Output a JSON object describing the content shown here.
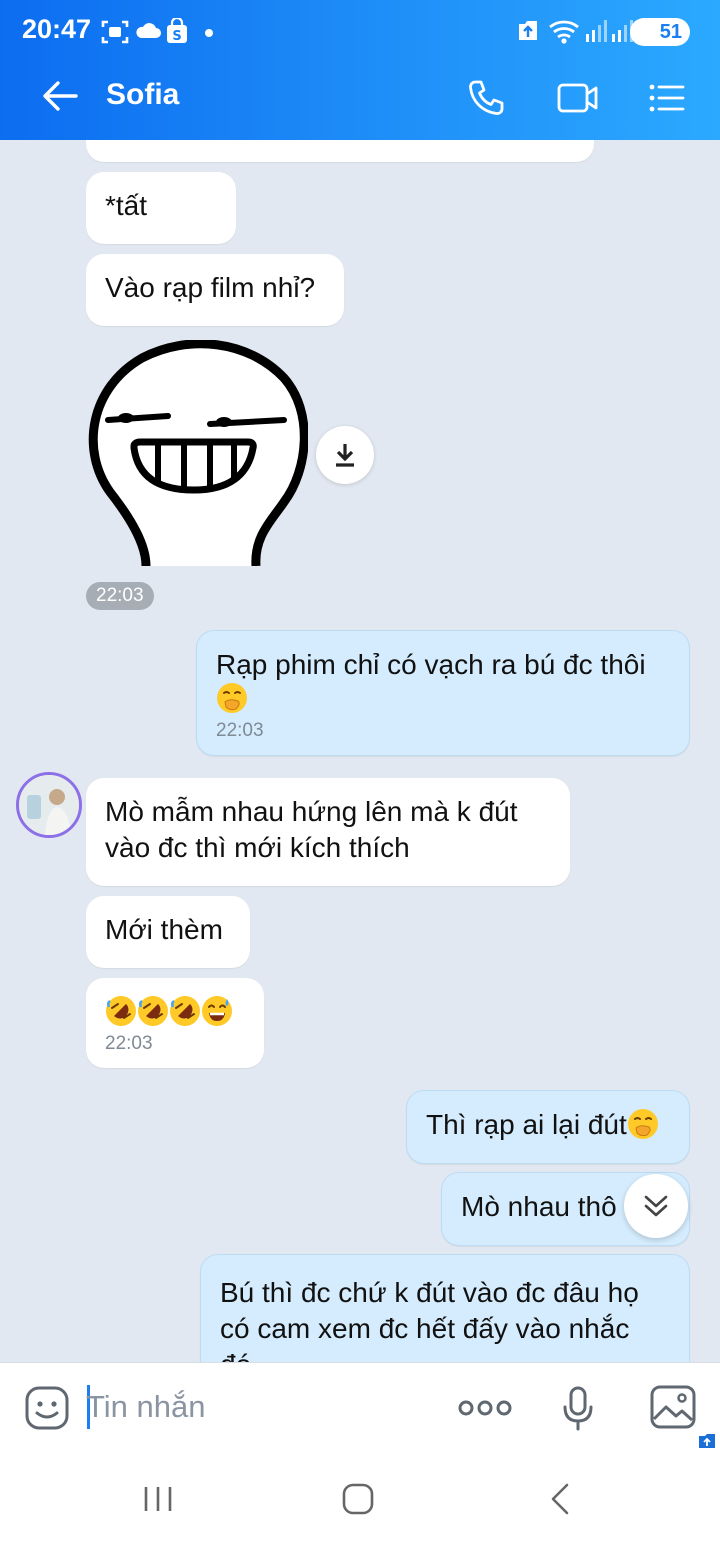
{
  "status_bar": {
    "time": "20:47",
    "battery": "51"
  },
  "header": {
    "contact_name": "Sofia"
  },
  "messages": {
    "m0": "*tất",
    "m1": "Vào rạp film nhỉ?",
    "sticker_time": "22:03",
    "m2_text": "Rạp phim chỉ có vạch ra bú đc thôi",
    "m2_time": "22:03",
    "m3_line1": "Mò mẫm nhau hứng lên mà k đút",
    "m3_line2": "vào đc thì mới kích thích",
    "m4": "Mới thèm",
    "m5_time": "22:03",
    "m6": "Thì rạp ai lại đút",
    "m7": "Mò nhau thô",
    "m8_line1": "Bú thì đc chứ k đút vào đc đâu họ",
    "m8_line2": "có cam xem đc hết đấy vào nhắc",
    "m8_line3": "đó"
  },
  "input": {
    "placeholder": "Tin nhắn"
  },
  "colors": {
    "header_start": "#0c6df0",
    "header_end": "#2ba9ff",
    "outgoing_bubble": "#d4ecfd",
    "incoming_bubble": "#ffffff",
    "chat_bg": "#e2e8f1"
  },
  "icons": [
    "back-arrow-icon",
    "phone-icon",
    "video-call-icon",
    "menu-list-icon",
    "download-icon",
    "double-chevron-down-icon",
    "sticker-icon",
    "more-dots-icon",
    "microphone-icon",
    "image-icon"
  ]
}
